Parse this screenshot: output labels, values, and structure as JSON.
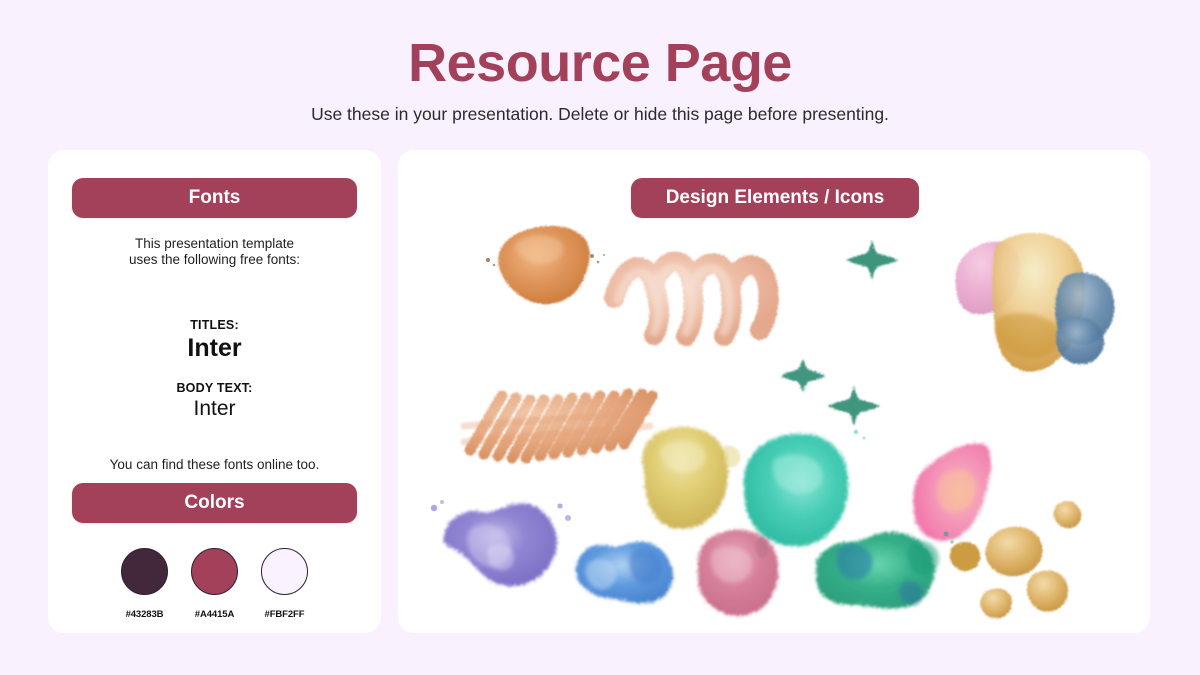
{
  "header": {
    "title": "Resource Page",
    "subtitle": "Use these in your presentation. Delete or hide this page before presenting."
  },
  "fonts_card": {
    "pill_label": "Fonts",
    "intro_line_1": "This presentation template",
    "intro_line_2": "uses the following free fonts:",
    "titles_role": "TITLES:",
    "titles_font": "Inter",
    "body_role": "BODY TEXT:",
    "body_font": "Inter",
    "outro": "You can find these fonts online too."
  },
  "colors_card": {
    "pill_label": "Colors",
    "swatches": [
      {
        "hex": "#43283B",
        "label": "#43283B"
      },
      {
        "hex": "#A4415A",
        "label": "#A4415A"
      },
      {
        "hex": "#FBF2FF",
        "label": "#FBF2FF"
      }
    ]
  },
  "elements_card": {
    "pill_label": "Design Elements / Icons",
    "graphics": [
      {
        "name": "orange-watercolor-blob",
        "color": "#D9863F"
      },
      {
        "name": "peach-zigzag-brushstroke",
        "color": "#E8B49C"
      },
      {
        "name": "orange-scribble-brushstroke",
        "color": "#E09A6B"
      },
      {
        "name": "yellow-watercolor-blob",
        "color": "#D9C35C"
      },
      {
        "name": "teal-watercolor-blob",
        "color": "#33C6AE"
      },
      {
        "name": "teal-cross-sparkle-large",
        "color": "#2E8B73"
      },
      {
        "name": "teal-cross-sparkle-small",
        "color": "#2E8B73"
      },
      {
        "name": "teal-cross-sparkle-medium",
        "color": "#2E8B73"
      },
      {
        "name": "pink-gold-blue-stone-cluster",
        "color": "#E3A94E"
      },
      {
        "name": "pink-coral-wedge-blob",
        "color": "#EE6FA6"
      },
      {
        "name": "purple-watercolor-splatter",
        "color": "#7A6DC7"
      },
      {
        "name": "blue-watercolor-splatter",
        "color": "#4A8BD6"
      },
      {
        "name": "rose-watercolor-blob",
        "color": "#CC6185"
      },
      {
        "name": "green-teal-watercolor-splatter",
        "color": "#2BA87B"
      },
      {
        "name": "gold-pebble-cluster",
        "color": "#D9A03F"
      }
    ]
  },
  "theme": {
    "background": "#F9F1FE",
    "card_background": "#FFFFFF",
    "accent": "#A4415A",
    "title_color": "#A4415A",
    "text_color": "#1f1f1f"
  }
}
